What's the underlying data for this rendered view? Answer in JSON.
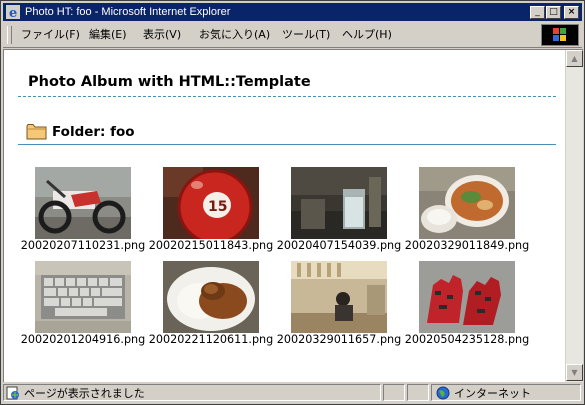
{
  "window": {
    "title": "Photo HT: foo - Microsoft Internet Explorer",
    "minimize_label": "_",
    "maximize_label": "□",
    "close_label": "×"
  },
  "menu": [
    "ファイル(F)",
    "編集(E)",
    "表示(V)",
    "お気に入り(A)",
    "ツール(T)",
    "ヘルプ(H)"
  ],
  "page": {
    "heading": "Photo Album with HTML::Template",
    "folder_title": "Folder: foo"
  },
  "photos": [
    {
      "filename": "20020207110231.png",
      "subject": "motorcycle"
    },
    {
      "filename": "20020215011843.png",
      "subject": "billiard-ball-15"
    },
    {
      "filename": "20020407154039.png",
      "subject": "glass-of-drink"
    },
    {
      "filename": "20020329011849.png",
      "subject": "bowl-of-ramen"
    },
    {
      "filename": "20020201204916.png",
      "subject": "keyboard"
    },
    {
      "filename": "20020221120611.png",
      "subject": "curry-rice"
    },
    {
      "filename": "20020329011657.png",
      "subject": "restaurant-interior"
    },
    {
      "filename": "20020504235128.png",
      "subject": "red-gloves"
    }
  ],
  "status": {
    "message": "ページが表示されました",
    "zone": "インターネット"
  },
  "icons": {
    "window": "ie-icon",
    "folder": "folder-icon",
    "status_page": "page-icon",
    "zone": "globe-icon"
  }
}
